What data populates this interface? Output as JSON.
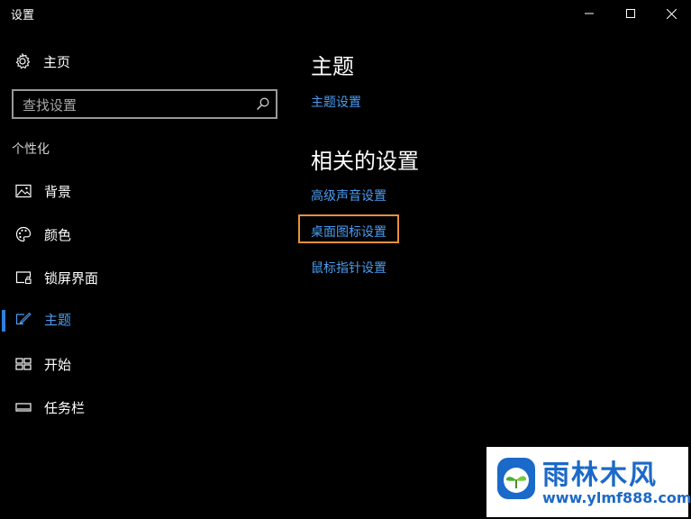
{
  "window": {
    "title": "设置",
    "controls": [
      "minimize-icon",
      "maximize-icon",
      "close-icon"
    ]
  },
  "sidebar": {
    "home_label": "主页",
    "search": {
      "placeholder": "查找设置",
      "value": ""
    },
    "section_label": "个性化",
    "items": [
      {
        "label": "背景",
        "icon": "picture-icon",
        "active": false
      },
      {
        "label": "颜色",
        "icon": "palette-icon",
        "active": false
      },
      {
        "label": "锁屏界面",
        "icon": "lock-screen-icon",
        "active": false
      },
      {
        "label": "主题",
        "icon": "theme-brush-icon",
        "active": true
      },
      {
        "label": "开始",
        "icon": "start-icon",
        "active": false
      },
      {
        "label": "任务栏",
        "icon": "taskbar-icon",
        "active": false
      }
    ]
  },
  "main": {
    "heading": "主题",
    "theme_settings_link": "主题设置",
    "related_heading": "相关的设置",
    "related_links": [
      "高级声音设置",
      "桌面图标设置",
      "鼠标指针设置"
    ]
  },
  "colors": {
    "background": "#000000",
    "link": "#4a9cf1",
    "accent": "#2f7fdc",
    "highlight_box": "#e8913a"
  },
  "watermark": {
    "text": "雨林木风",
    "url": "www.ylmf888.com"
  }
}
